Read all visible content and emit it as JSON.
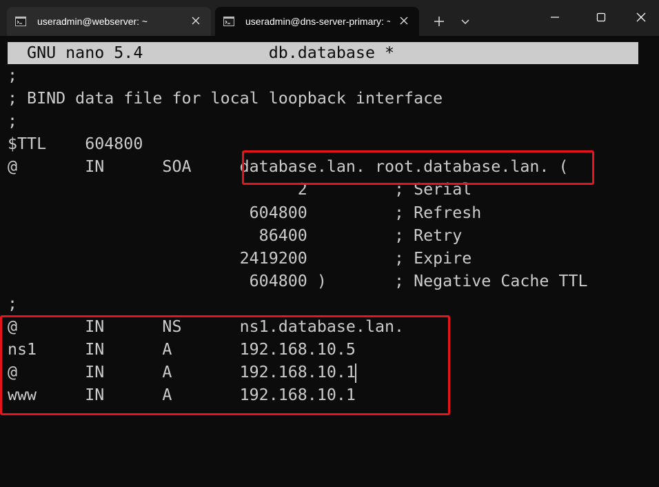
{
  "tabs": [
    {
      "title": "useradmin@webserver: ~"
    },
    {
      "title": "useradmin@dns-server-primary: ~"
    }
  ],
  "editor": {
    "header": "  GNU nano 5.4             db.database *",
    "lines": [
      ";",
      "; BIND data file for local loopback interface",
      ";",
      "$TTL    604800",
      "@       IN      SOA     database.lan. root.database.lan. (",
      "                              2         ; Serial",
      "                         604800         ; Refresh",
      "                          86400         ; Retry",
      "                        2419200         ; Expire",
      "                         604800 )       ; Negative Cache TTL",
      ";",
      "@       IN      NS      ns1.database.lan.",
      "ns1     IN      A       192.168.10.5",
      "@       IN      A       192.168.10.1",
      "www     IN      A       192.168.10.1"
    ]
  },
  "colors": {
    "background": "#0c0c0c",
    "text": "#cccccc",
    "highlight": "#e8141c"
  }
}
